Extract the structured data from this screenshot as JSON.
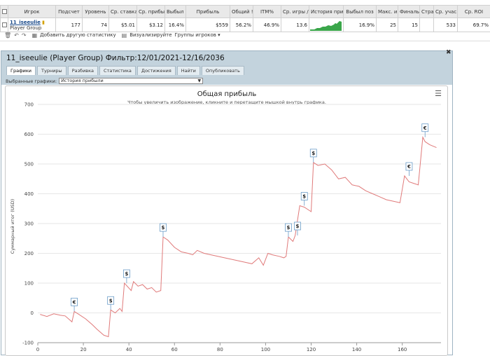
{
  "table": {
    "headers": [
      "",
      "Игрок",
      "Подсчет",
      "Уровень",
      "Ср. ставка",
      "Ср. прибыл",
      "Выбыл ра",
      "Прибыль",
      "Общий !",
      "ITM%",
      "Ср. игры /",
      "История при",
      "Выбыл поз",
      "Макс. и",
      "Финальн",
      "Стра",
      "Ср. учас",
      "Ср. ROI"
    ],
    "row": {
      "player_name": "11_iseeulie",
      "player_group": "Player Group",
      "count": "177",
      "level": "74",
      "avg_stake": "$5.01",
      "avg_profit": "$3.12",
      "early_out": "16.4%",
      "profit": "$559",
      "total": "56.2%",
      "itm": "46.9%",
      "avg_games": "13.6",
      "late_out": "16.9%",
      "max": "25",
      "final": "15",
      "country": "",
      "avg_players": "533",
      "avg_roi": "69.7%"
    }
  },
  "toolbar": {
    "add_stats": "Добавить другую статистику",
    "visualize": "Визуализируйте",
    "player_groups": "Группы игроков"
  },
  "dialog": {
    "title": "11_iseeulie (Player Group) Фильтр:12/01/2021-12/16/2036",
    "tabs": [
      "Графики",
      "Турниры",
      "Разбивка",
      "Статистика",
      "Достижения",
      "Найти",
      "Опубликовать"
    ],
    "selected_label": "Выбранные графики:",
    "selected_value": "История прибыли"
  },
  "chart_data": {
    "type": "line",
    "title": "Общая прибыль",
    "subtitle": "Чтобы увеличить изображение, кликните и перетащите мышкой внутрь графика.",
    "ylabel": "Суммарный итог (USD)",
    "xlim": [
      0,
      177
    ],
    "ylim": [
      -100,
      700
    ],
    "xticks": [
      0,
      20,
      40,
      60,
      80,
      100,
      120,
      140,
      160
    ],
    "yticks": [
      -100,
      0,
      100,
      200,
      300,
      400,
      500,
      600,
      700
    ],
    "grid": "y-only",
    "line_color": "#e07a7a",
    "series": [
      {
        "x": [
          1,
          4,
          7,
          10,
          12,
          15,
          16,
          18,
          21,
          24,
          26,
          29,
          31,
          32,
          34,
          36,
          37,
          38,
          41,
          42,
          44,
          46,
          48,
          50,
          52,
          54,
          55,
          57,
          60,
          63,
          66,
          68,
          70,
          73,
          76,
          79,
          82,
          85,
          88,
          91,
          94,
          97,
          99,
          101,
          103,
          106,
          108,
          109,
          110,
          112,
          113,
          115,
          117,
          120,
          121,
          123,
          126,
          129,
          132,
          135,
          138,
          141,
          144,
          147,
          150,
          153,
          156,
          159,
          161,
          162,
          163,
          165,
          167,
          169,
          170,
          172,
          175
        ],
        "y": [
          -5,
          -12,
          -3,
          -8,
          -10,
          -30,
          5,
          -5,
          -20,
          -40,
          -55,
          -75,
          -80,
          10,
          0,
          15,
          5,
          100,
          75,
          105,
          90,
          95,
          80,
          85,
          70,
          75,
          255,
          245,
          220,
          205,
          200,
          195,
          210,
          200,
          195,
          190,
          185,
          180,
          175,
          170,
          165,
          185,
          160,
          200,
          195,
          190,
          185,
          190,
          255,
          240,
          260,
          360,
          355,
          340,
          505,
          495,
          500,
          480,
          450,
          455,
          430,
          425,
          410,
          400,
          390,
          380,
          375,
          370,
          460,
          450,
          440,
          435,
          430,
          590,
          575,
          565,
          555
        ]
      }
    ],
    "markers": [
      {
        "x": 16,
        "y": 5,
        "label": "€"
      },
      {
        "x": 32,
        "y": 10,
        "label": "$"
      },
      {
        "x": 39,
        "y": 100,
        "label": "$"
      },
      {
        "x": 55,
        "y": 255,
        "label": "$"
      },
      {
        "x": 110,
        "y": 255,
        "label": "$"
      },
      {
        "x": 114,
        "y": 260,
        "label": "$"
      },
      {
        "x": 117,
        "y": 360,
        "label": "$"
      },
      {
        "x": 121,
        "y": 505,
        "label": "$"
      },
      {
        "x": 163,
        "y": 460,
        "label": "€"
      },
      {
        "x": 170,
        "y": 590,
        "label": "€"
      }
    ]
  }
}
